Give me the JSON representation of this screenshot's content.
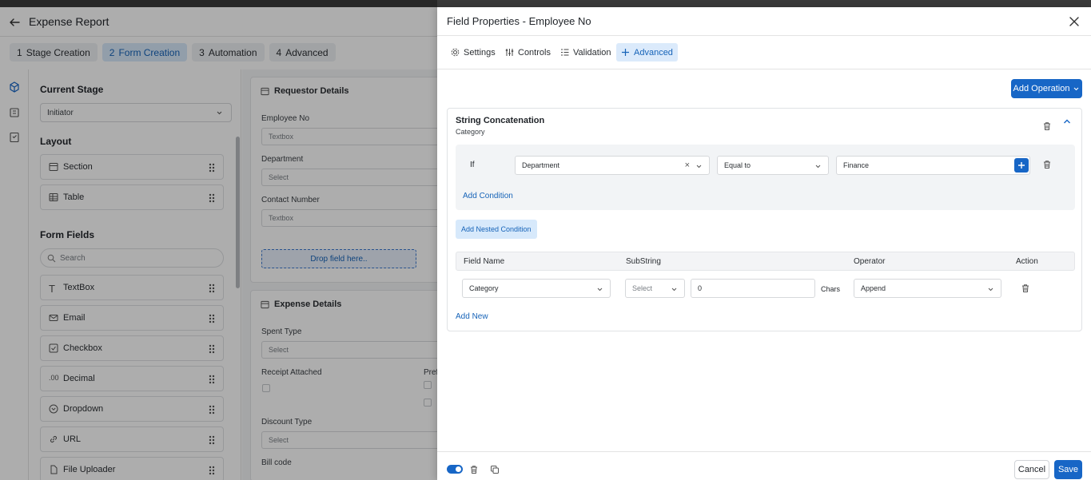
{
  "app": {
    "title": "Expense Report",
    "steps": [
      {
        "num": "1",
        "label": "Stage Creation"
      },
      {
        "num": "2",
        "label": "Form Creation"
      },
      {
        "num": "3",
        "label": "Automation"
      },
      {
        "num": "4",
        "label": "Advanced"
      }
    ],
    "active_step": 1
  },
  "left_panel": {
    "current_stage_heading": "Current Stage",
    "current_stage_value": "Initiator",
    "layout_heading": "Layout",
    "layout_items": [
      "Section",
      "Table"
    ],
    "form_fields_heading": "Form Fields",
    "search_placeholder": "Search",
    "form_fields": [
      "TextBox",
      "Email",
      "Checkbox",
      "Decimal",
      "Dropdown",
      "URL",
      "File Uploader"
    ]
  },
  "canvas": {
    "requestor_title": "Requestor Details",
    "employee_no_label": "Employee No",
    "employee_no_placeholder": "Textbox",
    "department_label": "Department",
    "department_placeholder": "Select",
    "contact_label": "Contact Number",
    "contact_placeholder": "Textbox",
    "drop_text": "Drop field here..",
    "expense_title": "Expense Details",
    "spent_type_label": "Spent Type",
    "spent_type_placeholder": "Select",
    "receipt_label": "Receipt Attached",
    "pref_label": "Pref",
    "discount_label": "Discount Type",
    "discount_placeholder": "Select",
    "bill_code_label": "Bill code"
  },
  "drawer": {
    "title": "Field Properties - Employee No",
    "tabs": [
      "Settings",
      "Controls",
      "Validation",
      "Advanced"
    ],
    "active_tab": 3,
    "add_operation_label": "Add Operation",
    "operation": {
      "title": "String Concatenation",
      "subtitle": "Category",
      "if_label": "If",
      "condition_field": "Department",
      "condition_operator": "Equal to",
      "condition_value": "Finance",
      "add_condition_label": "Add Condition",
      "add_nested_label": "Add Nested Condition",
      "columns": [
        "Field Name",
        "SubString",
        "Operator",
        "Action"
      ],
      "row": {
        "field_name": "Category",
        "substring": "Select",
        "chars_value": "0",
        "chars_label": "Chars",
        "operator": "Append"
      },
      "add_new_label": "Add New"
    },
    "footer": {
      "cancel_label": "Cancel",
      "save_label": "Save",
      "enabled": true
    }
  },
  "colors": {
    "primary": "#1766c6",
    "primary_light": "#d7e9fb",
    "overlay": "#000000"
  }
}
